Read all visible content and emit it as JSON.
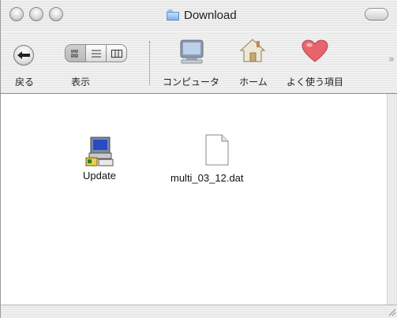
{
  "window": {
    "title": "Download",
    "title_icon": "folder-icon"
  },
  "toolbar": {
    "back_label": "戻る",
    "view_label": "表示",
    "computer_label": "コンピュータ",
    "home_label": "ホーム",
    "favorites_label": "よく使う項目",
    "overflow_glyph": "»"
  },
  "files": [
    {
      "name": "Update",
      "icon": "installer-computer-icon"
    },
    {
      "name": "multi_03_12.dat",
      "icon": "blank-document-icon"
    }
  ],
  "colors": {
    "folder_blue": "#7fb3e6",
    "heart_red": "#e8646c"
  }
}
